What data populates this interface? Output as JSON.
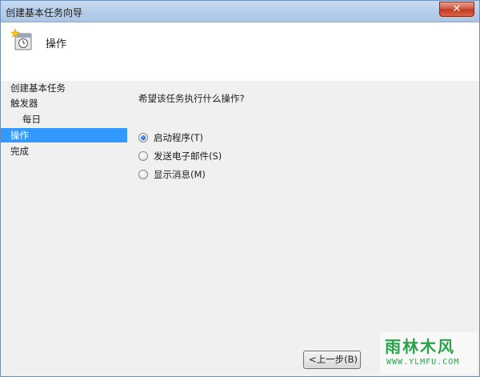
{
  "window": {
    "title": "创建基本任务向导",
    "close_glyph": "✕"
  },
  "header": {
    "title": "操作",
    "icon": "task-clock-icon"
  },
  "nav": {
    "items": [
      {
        "label": "创建基本任务"
      },
      {
        "label": "触发器"
      },
      {
        "label": "每日"
      },
      {
        "label": "操作"
      },
      {
        "label": "完成"
      }
    ]
  },
  "content": {
    "question": "希望该任务执行什么操作?",
    "options": [
      {
        "label": "启动程序(T)",
        "checked": true
      },
      {
        "label": "发送电子邮件(S)",
        "checked": false
      },
      {
        "label": "显示消息(M)",
        "checked": false
      }
    ]
  },
  "footer": {
    "back_label": "<上一步(B)"
  },
  "watermark": {
    "main": "雨林木风",
    "sub": "WWW.YLMFU.COM"
  },
  "colors": {
    "nav_active": "#3399ff",
    "watermark": "#2aa24a"
  }
}
